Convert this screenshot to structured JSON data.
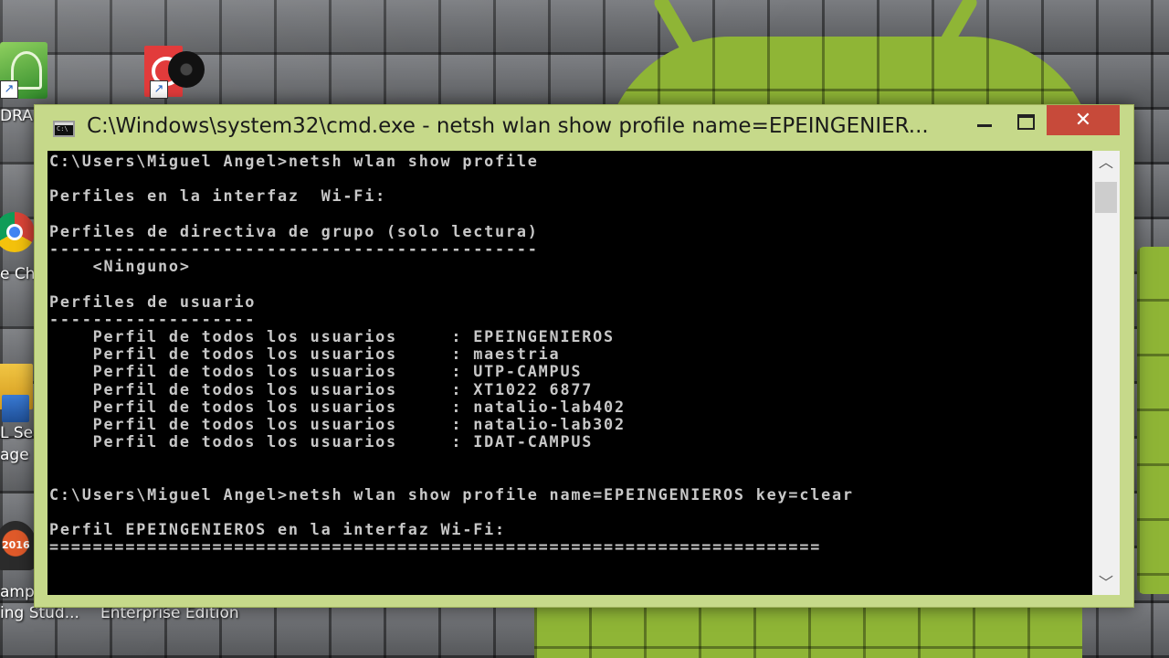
{
  "desktop": {
    "icons": [
      {
        "label": "DRA"
      },
      {
        "label": "e Ch"
      },
      {
        "label": "L Ser"
      },
      {
        "label": "age"
      },
      {
        "label": "amp"
      },
      {
        "label": "ing Stud..."
      },
      {
        "label": "Enterprise Edition"
      }
    ],
    "xampp_badge": "2016"
  },
  "window": {
    "title": "C:\\Windows\\system32\\cmd.exe - netsh  wlan show profile name=EPEINGENIER...",
    "controls": {
      "minimize": "minimize",
      "maximize": "maximize",
      "close": "✕"
    },
    "console_lines": [
      "C:\\Users\\Miguel Angel>netsh wlan show profile",
      "",
      "Perfiles en la interfaz  Wi-Fi:",
      "",
      "Perfiles de directiva de grupo (solo lectura)",
      "---------------------------------------------",
      "    <Ninguno>",
      "",
      "Perfiles de usuario",
      "-------------------",
      "    Perfil de todos los usuarios     : EPEINGENIEROS",
      "    Perfil de todos los usuarios     : maestria",
      "    Perfil de todos los usuarios     : UTP-CAMPUS",
      "    Perfil de todos los usuarios     : XT1022 6877",
      "    Perfil de todos los usuarios     : natalio-lab402",
      "    Perfil de todos los usuarios     : natalio-lab302",
      "    Perfil de todos los usuarios     : IDAT-CAMPUS",
      "",
      "",
      "C:\\Users\\Miguel Angel>netsh wlan show profile name=EPEINGENIEROS key=clear",
      "",
      "Perfil EPEINGENIEROS en la interfaz Wi-Fi:",
      "======================================================================="
    ]
  },
  "scrollbar": {
    "up": "︿",
    "down": "﹀"
  },
  "colors": {
    "titlebar": "#c6d98a",
    "close_button": "#c74a3a",
    "console_bg": "#000000",
    "console_text": "#c8c8c8",
    "android_green": "#8fb536"
  }
}
